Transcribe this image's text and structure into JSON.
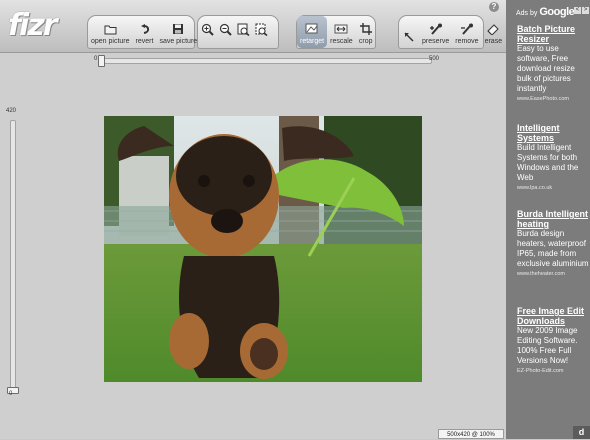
{
  "app": {
    "logo": "fizr",
    "help": "?"
  },
  "toolbar": {
    "file": [
      {
        "label": "open picture",
        "icon": "folder-icon"
      },
      {
        "label": "revert",
        "icon": "revert-icon"
      },
      {
        "label": "save picture",
        "icon": "save-icon"
      }
    ],
    "zoom": [
      {
        "icon": "zoom-in-icon"
      },
      {
        "icon": "zoom-out-icon"
      },
      {
        "icon": "zoom-actual-icon"
      },
      {
        "icon": "zoom-fit-icon"
      }
    ],
    "modes": [
      {
        "label": "retarget",
        "icon": "retarget-icon",
        "selected": true
      },
      {
        "label": "rescale",
        "icon": "rescale-icon",
        "selected": false
      },
      {
        "label": "crop",
        "icon": "crop-icon",
        "selected": false
      }
    ],
    "tools": [
      {
        "label": "",
        "icon": "pointer-icon"
      },
      {
        "label": "preserve",
        "icon": "preserve-brush-icon"
      },
      {
        "label": "remove",
        "icon": "remove-brush-icon"
      },
      {
        "label": "erase",
        "icon": "eraser-icon"
      }
    ]
  },
  "width_slider": {
    "min": "0",
    "max": "500",
    "value": 0
  },
  "height_slider": {
    "min": "0",
    "max": "420",
    "value": 0
  },
  "status": "500x420 @ 100%",
  "ads": {
    "header_prefix": "Ads by",
    "header_brand": "Google",
    "items": [
      {
        "title": "Batch Picture Resizer",
        "body": "Easy to use software, Free download resize bulk of pictures instantly",
        "url": "www.EasePhoto.com"
      },
      {
        "title": "Intelligent Systems",
        "body": "Build Intelligent Systems for both Windows and the Web",
        "url": "www.lpa.co.uk"
      },
      {
        "title": "Burda Intelligent heating",
        "body": "Burda design heaters, waterproof IP65, made from exclusive aluminium",
        "url": "www.theheater.com"
      },
      {
        "title": "Free Image Edit Downloads",
        "body": "New 2009 Image Editing Software. 100% Free Full Versions Now!",
        "url": "EZ-Photo-Edit.com"
      }
    ],
    "corner": "d"
  },
  "colors": {
    "toolbar": "#d0d0d0",
    "canvas_bg": "#cfcfcf",
    "ads_bg": "#7c7c7c",
    "selected_tool": "#9aa6b4"
  }
}
